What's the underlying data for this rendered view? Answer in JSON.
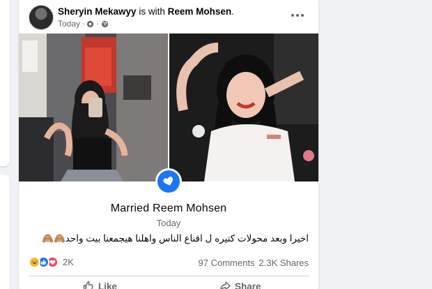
{
  "post": {
    "author": "Sheryin Mekawyy",
    "with_text": "is with",
    "tagged": "Reem Mohsen",
    "tagged_suffix": ".",
    "time": "Today",
    "event_title": "Married Reem Mohsen",
    "event_date": "Today",
    "caption": "اخيرا وبعد محولات كتيره ل اقناع الناس واهلنا هيجمعنا بيت واحد🙈🙈",
    "reactions_count": "2K",
    "comments": "97 Comments",
    "shares": "2.3K Shares",
    "like_label": "Like",
    "share_label": "Share"
  },
  "colors": {
    "accent": "#1877f2",
    "muted_text": "#65676b",
    "page_bg": "#f0f2f5"
  },
  "icons": {
    "privacy": "globe-icon",
    "time_sep": "dot",
    "event": "heart-icon",
    "more": "more-horizontal-icon"
  }
}
